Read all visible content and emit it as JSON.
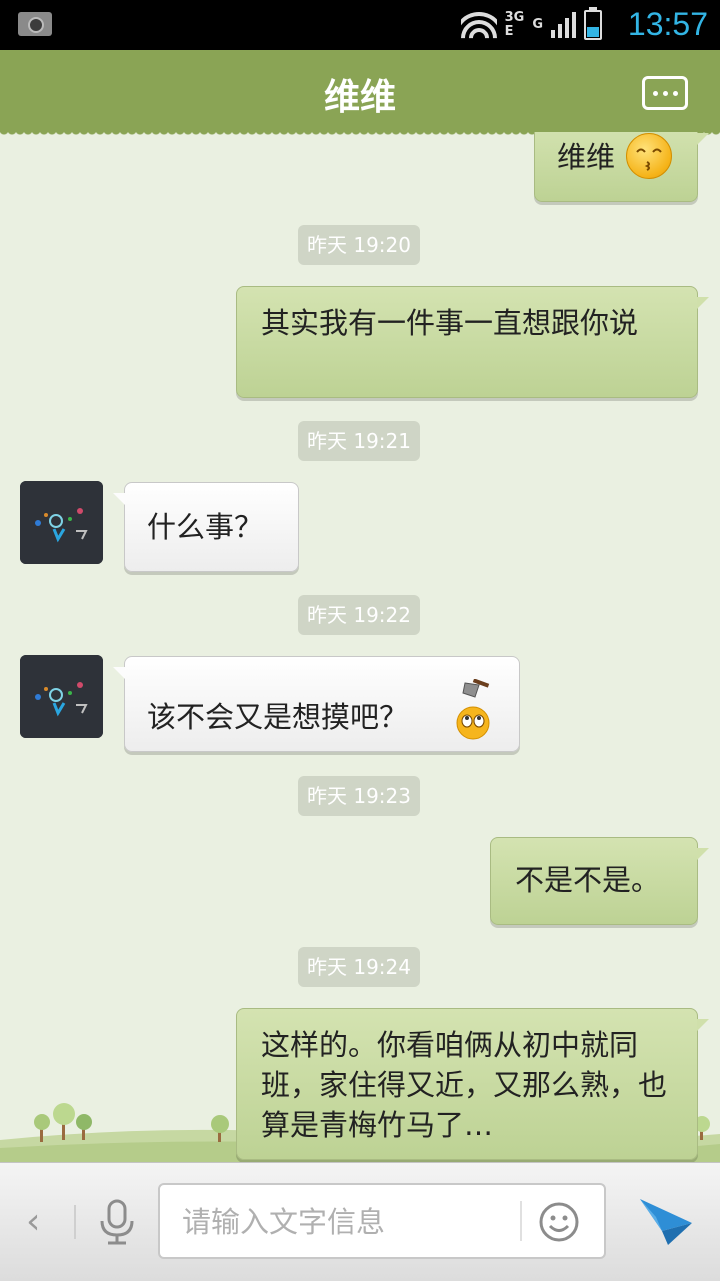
{
  "status_bar": {
    "time": "13:57",
    "network": "3G",
    "network2": "E",
    "network3": "G"
  },
  "header": {
    "title": "维维"
  },
  "messages": [
    {
      "type": "text",
      "dir": "out",
      "text": "维维",
      "emoji": "kiss-emoji"
    },
    {
      "type": "time",
      "text": "昨天 19:20"
    },
    {
      "type": "text",
      "dir": "out",
      "text": "其实我有一件事一直想跟你说"
    },
    {
      "type": "time",
      "text": "昨天 19:21"
    },
    {
      "type": "text",
      "dir": "in",
      "text": "什么事？"
    },
    {
      "type": "time",
      "text": "昨天 19:22"
    },
    {
      "type": "text",
      "dir": "in",
      "text": "该不会又是想摸吧？",
      "emoji": "axe-rolleyes-emoji"
    },
    {
      "type": "time",
      "text": "昨天 19:23"
    },
    {
      "type": "text",
      "dir": "out",
      "text": "不是不是。"
    },
    {
      "type": "time",
      "text": "昨天 19:24"
    },
    {
      "type": "text",
      "dir": "out",
      "text": "这样的。你看咱俩从初中就同班，家住得又近，又那么熟，也算是青梅竹马了…"
    }
  ],
  "input": {
    "placeholder": "请输入文字信息",
    "value": ""
  },
  "colors": {
    "header": "#8aa455",
    "out_bubble": "#c9dba2",
    "background": "#eaf0e1",
    "status_accent": "#33b5e5"
  }
}
